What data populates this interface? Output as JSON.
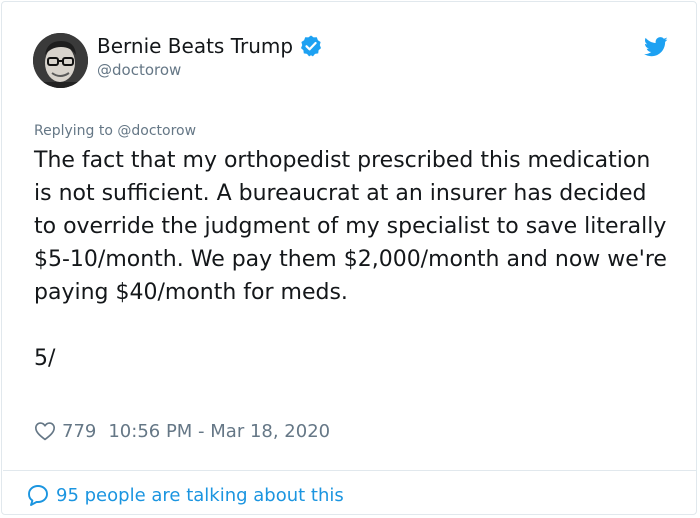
{
  "author": {
    "display_name": "Bernie Beats Trump",
    "handle": "@doctorow",
    "verified": true,
    "avatar_icon": "person-photo-avatar"
  },
  "tweet": {
    "reply_to": "Replying to @doctorow",
    "text": "The fact that my orthopedist prescribed this medication is not sufficient. A bureaucrat at an insurer has decided to override the judgment of my specialist to save literally $5-10/month. We pay them $2,000/month and now we're paying $40/month for meds.",
    "counter": "5/",
    "likes": "779",
    "timestamp": "10:56 PM - Mar 18, 2020"
  },
  "footer": {
    "talking": "95 people are talking about this"
  },
  "icons": {
    "verified": "verified-badge-icon",
    "bird": "twitter-bird-icon",
    "heart": "heart-icon",
    "bubble": "speech-bubble-icon"
  },
  "colors": {
    "brand_blue": "#1da1f2",
    "link_blue": "#1b95e0",
    "secondary_text": "#657786",
    "primary_text": "#14171a",
    "border": "#e1e8ed"
  }
}
